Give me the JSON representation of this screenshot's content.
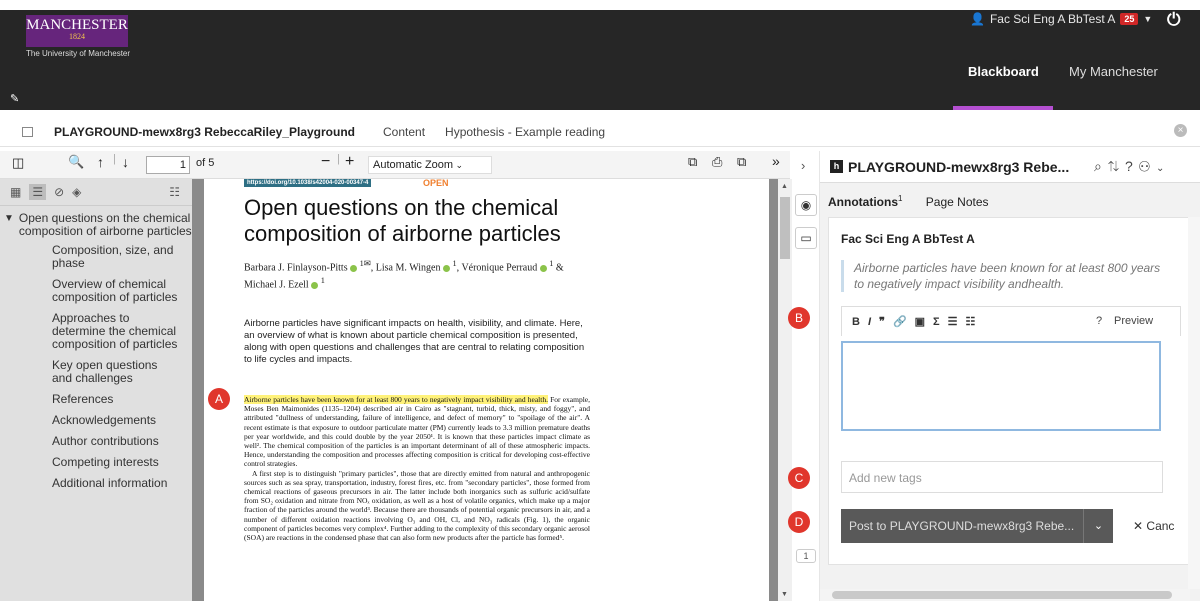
{
  "header": {
    "logo_main": "MANCHESTER",
    "logo_year": "1824",
    "university": "The University of Manchester",
    "user_name": "Fac Sci Eng A BbTest A",
    "notification_count": "25",
    "nav_blackboard": "Blackboard",
    "nav_my_manchester": "My Manchester",
    "accent_color": "#b44fd1",
    "logo_color": "#66257c"
  },
  "breadcrumb": {
    "course": "PLAYGROUND-mewx8rg3 RebeccaRiley_Playground",
    "content": "Content",
    "page": "Hypothesis - Example reading"
  },
  "pdf_toolbar": {
    "page_number": "1",
    "page_total": "of 5",
    "zoom": "Automatic Zoom"
  },
  "outline": {
    "top": "Open questions on the chemical composition of airborne particles",
    "items": [
      "Composition, size, and phase",
      "Overview of chemical composition of particles",
      "Approaches to determine the chemical composition of particles",
      "Key open questions and challenges",
      "References",
      "Acknowledgements",
      "Author contributions",
      "Competing interests",
      "Additional information"
    ]
  },
  "document": {
    "doi": "https://doi.org/10.1038/s42004-020-00347-4",
    "open_label": "OPEN",
    "title": "Open questions on the chemical composition of airborne particles",
    "authors_line1": "Barbara J. Finlayson-Pitts",
    "authors_sup1": "1✉",
    "authors_mid": ", Lisa M. Wingen",
    "authors_sup2": "1",
    "authors_mid2": ", Véronique Perraud",
    "authors_sup3": "1",
    "authors_end": " &",
    "authors_line2": "Michael J. Ezell",
    "authors_sup4": "1",
    "abstract": "Airborne particles have significant impacts on health, visibility, and climate. Here, an overview of what is known about particle chemical composition is presented, along with open questions and challenges that are central to relating composition to life cycles and impacts.",
    "body_highlight": "Airborne particles have been known for at least 800 years to negatively impact visibility and health.",
    "body_rest": " For example, Moses Ben Maimonides (1135–1204) described air in Cairo as \"stagnant, turbid, thick, misty, and foggy\", and attributed \"dullness of understanding, failure of intelligence, and defect of memory\" to \"spoilage of the air\". A recent estimate is that exposure to outdoor particulate matter (PM) currently leads to 3.3 million premature deaths per year worldwide, and this could double by the year 2050¹. It is known that these particles impact climate as well². The chemical composition of the particles is an important determinant of all of these atmospheric impacts. Hence, understanding the composition and processes affecting composition is critical for developing cost-effective control strategies.",
    "body_p2": "A first step is to distinguish \"primary particles\", those that are directly emitted from natural and anthropogenic sources such as sea spray, transportation, industry, forest fires, etc. from \"secondary particles\", those formed from chemical reactions of gaseous precursors in air. The latter include both inorganics such as sulfuric acid/sulfate from SO₂ oxidation and nitrate from NOₓ oxidation, as well as a host of volatile organics, which make up a major fraction of the particles around the world³. Because there are thousands of potential organic precursors in air, and a number of different oxidation reactions involving O₃ and OH, Cl, and NO₃ radicals (Fig. 1), the organic component of particles becomes very complex⁴. Further adding to the complexity of this secondary organic aerosol (SOA) are reactions in the condensed phase that can also form new products after the particle has formed⁵."
  },
  "markers": {
    "a": "A",
    "b": "B",
    "c": "C",
    "d": "D"
  },
  "hypothesis": {
    "group_title": "PLAYGROUND-mewx8rg3 Rebe...",
    "tab_annotations": "Annotations",
    "annotations_count": "1",
    "tab_page_notes": "Page Notes",
    "bucket_count": "1",
    "card_user": "Fac Sci Eng A BbTest A",
    "quote": "Airborne particles have been known for at least 800 years to negatively impact visibility andhealth.",
    "preview": "Preview",
    "help": "?",
    "tags_placeholder": "Add new tags",
    "post_label": "Post to PLAYGROUND-mewx8rg3 Rebe...",
    "cancel_label": "Canc"
  }
}
